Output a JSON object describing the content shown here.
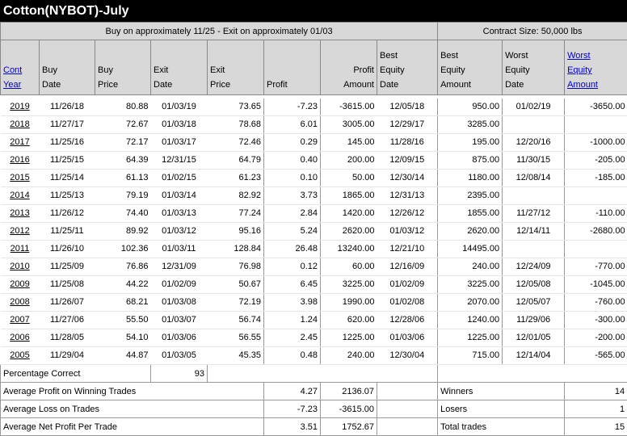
{
  "title": "Cotton(NYBOT)-July",
  "header": {
    "strategy": "Buy on approximately 11/25 - Exit on approximately 01/03",
    "contract": "Contract Size: 50,000 lbs",
    "cols": {
      "cont_year_1": "Cont",
      "cont_year_2": "Year",
      "buy_date_1": "Buy",
      "buy_date_2": "Date",
      "buy_price_1": "Buy",
      "buy_price_2": "Price",
      "exit_date_1": "Exit",
      "exit_date_2": "Date",
      "exit_price_1": "Exit",
      "exit_price_2": "Price",
      "profit": "Profit",
      "profit_amount_1": "Profit",
      "profit_amount_2": "Amount",
      "bed_1": "Best",
      "bed_2": "Equity",
      "bed_3": "Date",
      "bea_1": "Best",
      "bea_2": "Equity",
      "bea_3": "Amount",
      "wed_1": "Worst",
      "wed_2": "Equity",
      "wed_3": "Date",
      "wea_1": "Worst",
      "wea_2": "Equity",
      "wea_3": "Amount"
    }
  },
  "rows": [
    {
      "year": "2019",
      "buy_date": "11/26/18",
      "buy_price": "80.88",
      "exit_date": "01/03/19",
      "exit_price": "73.65",
      "profit": "-7.23",
      "amount": "-3615.00",
      "best_date": "12/05/18",
      "best_amount": "950.00",
      "worst_date": "01/02/19",
      "worst_amount": "-3650.00"
    },
    {
      "year": "2018",
      "buy_date": "11/27/17",
      "buy_price": "72.67",
      "exit_date": "01/03/18",
      "exit_price": "78.68",
      "profit": "6.01",
      "amount": "3005.00",
      "best_date": "12/29/17",
      "best_amount": "3285.00",
      "worst_date": "",
      "worst_amount": ""
    },
    {
      "year": "2017",
      "buy_date": "11/25/16",
      "buy_price": "72.17",
      "exit_date": "01/03/17",
      "exit_price": "72.46",
      "profit": "0.29",
      "amount": "145.00",
      "best_date": "11/28/16",
      "best_amount": "195.00",
      "worst_date": "12/20/16",
      "worst_amount": "-1000.00"
    },
    {
      "year": "2016",
      "buy_date": "11/25/15",
      "buy_price": "64.39",
      "exit_date": "12/31/15",
      "exit_price": "64.79",
      "profit": "0.40",
      "amount": "200.00",
      "best_date": "12/09/15",
      "best_amount": "875.00",
      "worst_date": "11/30/15",
      "worst_amount": "-205.00"
    },
    {
      "year": "2015",
      "buy_date": "11/25/14",
      "buy_price": "61.13",
      "exit_date": "01/02/15",
      "exit_price": "61.23",
      "profit": "0.10",
      "amount": "50.00",
      "best_date": "12/30/14",
      "best_amount": "1180.00",
      "worst_date": "12/08/14",
      "worst_amount": "-185.00"
    },
    {
      "year": "2014",
      "buy_date": "11/25/13",
      "buy_price": "79.19",
      "exit_date": "01/03/14",
      "exit_price": "82.92",
      "profit": "3.73",
      "amount": "1865.00",
      "best_date": "12/31/13",
      "best_amount": "2395.00",
      "worst_date": "",
      "worst_amount": ""
    },
    {
      "year": "2013",
      "buy_date": "11/26/12",
      "buy_price": "74.40",
      "exit_date": "01/03/13",
      "exit_price": "77.24",
      "profit": "2.84",
      "amount": "1420.00",
      "best_date": "12/26/12",
      "best_amount": "1855.00",
      "worst_date": "11/27/12",
      "worst_amount": "-110.00"
    },
    {
      "year": "2012",
      "buy_date": "11/25/11",
      "buy_price": "89.92",
      "exit_date": "01/03/12",
      "exit_price": "95.16",
      "profit": "5.24",
      "amount": "2620.00",
      "best_date": "01/03/12",
      "best_amount": "2620.00",
      "worst_date": "12/14/11",
      "worst_amount": "-2680.00"
    },
    {
      "year": "2011",
      "buy_date": "11/26/10",
      "buy_price": "102.36",
      "exit_date": "01/03/11",
      "exit_price": "128.84",
      "profit": "26.48",
      "amount": "13240.00",
      "best_date": "12/21/10",
      "best_amount": "14495.00",
      "worst_date": "",
      "worst_amount": ""
    },
    {
      "year": "2010",
      "buy_date": "11/25/09",
      "buy_price": "76.86",
      "exit_date": "12/31/09",
      "exit_price": "76.98",
      "profit": "0.12",
      "amount": "60.00",
      "best_date": "12/16/09",
      "best_amount": "240.00",
      "worst_date": "12/24/09",
      "worst_amount": "-770.00"
    },
    {
      "year": "2009",
      "buy_date": "11/25/08",
      "buy_price": "44.22",
      "exit_date": "01/02/09",
      "exit_price": "50.67",
      "profit": "6.45",
      "amount": "3225.00",
      "best_date": "01/02/09",
      "best_amount": "3225.00",
      "worst_date": "12/05/08",
      "worst_amount": "-1045.00"
    },
    {
      "year": "2008",
      "buy_date": "11/26/07",
      "buy_price": "68.21",
      "exit_date": "01/03/08",
      "exit_price": "72.19",
      "profit": "3.98",
      "amount": "1990.00",
      "best_date": "01/02/08",
      "best_amount": "2070.00",
      "worst_date": "12/05/07",
      "worst_amount": "-760.00"
    },
    {
      "year": "2007",
      "buy_date": "11/27/06",
      "buy_price": "55.50",
      "exit_date": "01/03/07",
      "exit_price": "56.74",
      "profit": "1.24",
      "amount": "620.00",
      "best_date": "12/28/06",
      "best_amount": "1240.00",
      "worst_date": "11/29/06",
      "worst_amount": "-300.00"
    },
    {
      "year": "2006",
      "buy_date": "11/28/05",
      "buy_price": "54.10",
      "exit_date": "01/03/06",
      "exit_price": "56.55",
      "profit": "2.45",
      "amount": "1225.00",
      "best_date": "01/03/06",
      "best_amount": "1225.00",
      "worst_date": "12/01/05",
      "worst_amount": "-200.00"
    },
    {
      "year": "2005",
      "buy_date": "11/29/04",
      "buy_price": "44.87",
      "exit_date": "01/03/05",
      "exit_price": "45.35",
      "profit": "0.48",
      "amount": "240.00",
      "best_date": "12/30/04",
      "best_amount": "715.00",
      "worst_date": "12/14/04",
      "worst_amount": "-565.00"
    }
  ],
  "summary": {
    "pct_label": "Percentage Correct",
    "pct_value": "93",
    "avg_win_label": "Average Profit on Winning Trades",
    "avg_win_profit": "4.27",
    "avg_win_amount": "2136.07",
    "avg_loss_label": "Average Loss on Trades",
    "avg_loss_profit": "-7.23",
    "avg_loss_amount": "-3615.00",
    "avg_net_label": "Average Net Profit Per Trade",
    "avg_net_profit": "3.51",
    "avg_net_amount": "1752.67",
    "winners_label": "Winners",
    "winners_value": "14",
    "losers_label": "Losers",
    "losers_value": "1",
    "total_label": "Total trades",
    "total_value": "15"
  }
}
